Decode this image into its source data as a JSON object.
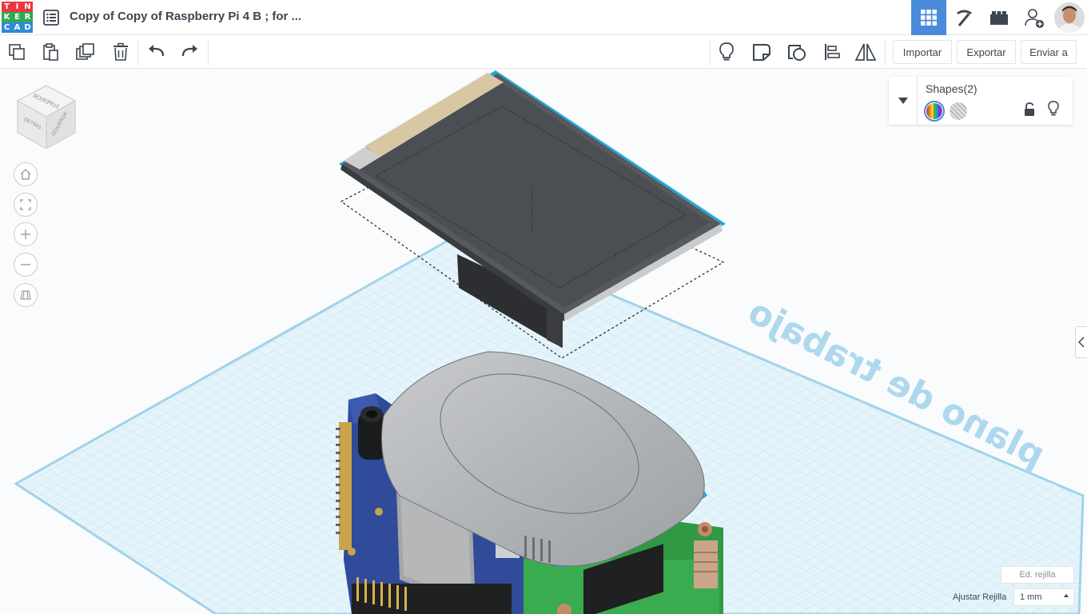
{
  "header": {
    "logo_letters": [
      "T",
      "I",
      "N",
      "K",
      "E",
      "R",
      "C",
      "A",
      "D"
    ],
    "logo_colors": [
      "#e8383d",
      "#e8383d",
      "#e8383d",
      "#32a852",
      "#32a852",
      "#32a852",
      "#2f8ad8",
      "#2f8ad8",
      "#2f8ad8"
    ],
    "design_title": "Copy of Copy of Raspberry Pi 4 B ; for ...",
    "modes": [
      "grid-view-icon",
      "pickaxe-icon",
      "bricks-icon"
    ],
    "active_mode": "grid-view-icon",
    "accent": "#4a8bdb"
  },
  "toolbar": {
    "left_tools": [
      "copy-icon",
      "paste-icon",
      "duplicate-icon",
      "delete-icon",
      "undo-icon",
      "redo-icon"
    ],
    "right_tools": [
      "lightbulb-icon",
      "note-icon",
      "workplane-icon",
      "align-icon",
      "mirror-icon"
    ],
    "import_label": "Importar",
    "export_label": "Exportar",
    "send_label": "Enviar a"
  },
  "viewcube": {
    "top_face": "SUPERIOR",
    "left_face": "DETRÁS",
    "right_face": "IZQUIERDA"
  },
  "view_nav": [
    "home-icon",
    "fit-view-icon",
    "zoom-in-icon",
    "zoom-out-icon",
    "perspective-icon"
  ],
  "workplane": {
    "label": "plano de trabajo",
    "grid_color": "#a9d7ee"
  },
  "shapes_panel": {
    "title": "Shapes(2)",
    "solid_icon": "rainbow-solid-icon",
    "hole_icon": "hole-icon",
    "lock_icon": "unlock-icon",
    "visibility_icon": "lightbulb-icon"
  },
  "grid_settings": {
    "edit_grid_label": "Ed. rejilla",
    "snap_label": "Ajustar Rejilla",
    "snap_value": "1 mm"
  }
}
